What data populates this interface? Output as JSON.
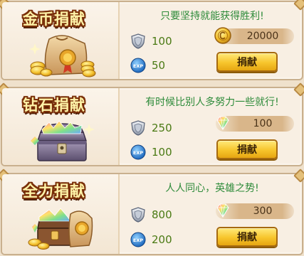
{
  "panels": [
    {
      "title": "金币捐献",
      "slogan": "只要坚持就能获得胜利!",
      "honor_value": "100",
      "exp_value": "50",
      "cost_value": "20000",
      "cost_icon": "gold-coin-icon",
      "button_label": "捐献"
    },
    {
      "title": "钻石捐献",
      "slogan": "有时候比别人多努力一些就行!",
      "honor_value": "250",
      "exp_value": "100",
      "cost_value": "100",
      "cost_icon": "diamond-icon",
      "button_label": "捐献"
    },
    {
      "title": "全力捐献",
      "slogan": "人人同心，英雄之势!",
      "honor_value": "800",
      "exp_value": "200",
      "cost_value": "300",
      "cost_icon": "diamond-icon",
      "button_label": "捐献"
    }
  ],
  "exp_badge_text": "EXP",
  "colors": {
    "slogan": "#2e8b3a",
    "value": "#4a7a14",
    "button": "#f7c52c",
    "title_fill": "#fff3a8",
    "title_outline": "#7a2f08"
  }
}
